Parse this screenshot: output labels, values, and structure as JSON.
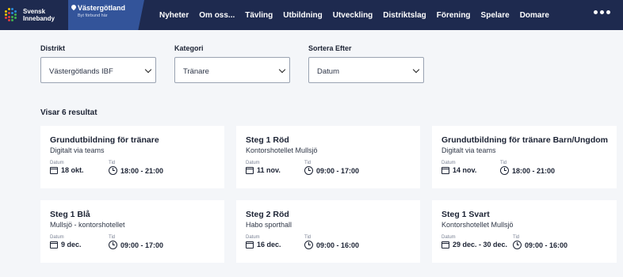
{
  "header": {
    "logo_line1": "Svensk",
    "logo_line2": "Innebandy",
    "region_title": "Västergötland",
    "region_sub": "Byt förbund här",
    "nav": [
      "Nyheter",
      "Om oss...",
      "Tävling",
      "Utbildning",
      "Utveckling",
      "Distriktslag",
      "Förening",
      "Spelare",
      "Domare"
    ]
  },
  "filters": {
    "district": {
      "label": "Distrikt",
      "value": "Västergötlands IBF"
    },
    "category": {
      "label": "Kategori",
      "value": "Tränare"
    },
    "sort": {
      "label": "Sortera Efter",
      "value": "Datum"
    }
  },
  "results_label": "Visar 6 resultat",
  "date_label": "Datum",
  "time_label": "Tid",
  "cards": [
    {
      "title": "Grundutbildning för tränare",
      "location": "Digitalt via teams",
      "date": "18 okt.",
      "time": "18:00 - 21:00"
    },
    {
      "title": "Steg 1 Röd",
      "location": "Kontorshotellet Mullsjö",
      "date": "11 nov.",
      "time": "09:00 - 17:00"
    },
    {
      "title": "Grundutbildning för tränare Barn/Ungdom",
      "location": "Digitalt via teams",
      "date": "14 nov.",
      "time": "18:00 - 21:00"
    },
    {
      "title": "Steg 1 Blå",
      "location": "Mullsjö - kontorshotellet",
      "date": "9 dec.",
      "time": "09:00 - 17:00"
    },
    {
      "title": "Steg 2 Röd",
      "location": "Habo sporthall",
      "date": "16 dec.",
      "time": "09:00 - 16:00"
    },
    {
      "title": "Steg 1 Svart",
      "location": "Kontorshotellet Mullsjö",
      "date": "29 dec. - 30 dec.",
      "time": "09:00 - 16:00"
    }
  ],
  "colors": {
    "header_bg": "#1e2a4f",
    "region_bg": "#33549a",
    "page_bg": "#f4f6f9",
    "logo_dots": [
      "#f5c400",
      "#2a8bd8",
      "#e23c3c",
      "#3fb34f"
    ]
  }
}
